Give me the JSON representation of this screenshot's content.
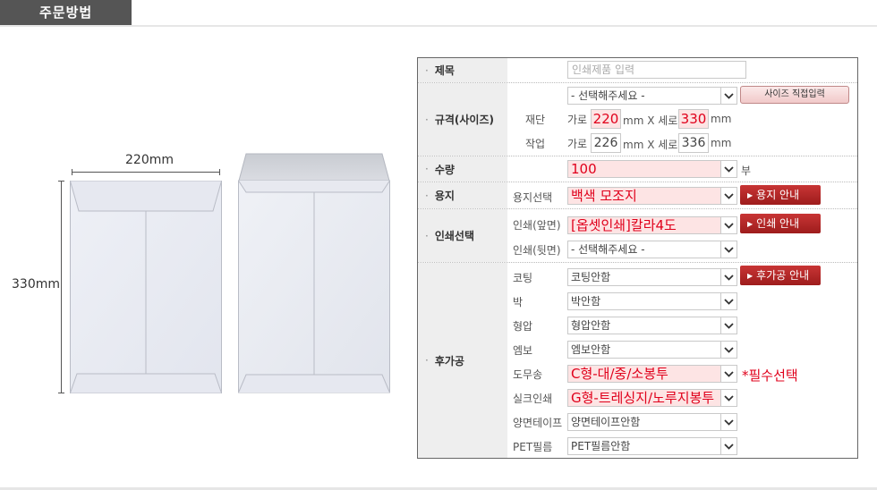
{
  "header": {
    "tab_title": "주문방법"
  },
  "illustration": {
    "width_label": "220mm",
    "height_label": "330mm"
  },
  "form": {
    "title_row": {
      "label": "제목",
      "input_placeholder": "인쇄제품 입력"
    },
    "size_row": {
      "label": "규격(사이즈)",
      "select_value": "- 선택해주세요 -",
      "direct_button": "사이즈 직접입력",
      "cut": {
        "label": "재단",
        "w_label": "가로",
        "w_value": "220",
        "unit1": "mm X 세로",
        "h_value": "330",
        "unit2": "mm"
      },
      "work": {
        "label": "작업",
        "w_label": "가로",
        "w_value": "226",
        "unit1": "mm X 세로",
        "h_value": "336",
        "unit2": "mm"
      }
    },
    "qty_row": {
      "label": "수량",
      "select_value": "100",
      "unit": "부"
    },
    "paper_row": {
      "label": "용지",
      "sublabel": "용지선택",
      "select_value": "백색 모조지",
      "guide_button": "용지 안내"
    },
    "print_row": {
      "label": "인쇄선택",
      "front_label": "인쇄(앞면)",
      "front_value": "[옵셋인쇄]칼라4도",
      "guide_button": "인쇄 안내",
      "back_label": "인쇄(뒷면)",
      "back_value": "- 선택해주세요 -"
    },
    "post_row": {
      "label": "후가공",
      "guide_button": "후가공 안내",
      "required_note": "*필수선택",
      "items": [
        {
          "label": "코팅",
          "value": "코팅안함",
          "highlight": false
        },
        {
          "label": "박",
          "value": "박안함",
          "highlight": false
        },
        {
          "label": "형압",
          "value": "형압안함",
          "highlight": false
        },
        {
          "label": "엠보",
          "value": "엠보안함",
          "highlight": false
        },
        {
          "label": "도무송",
          "value": "C형-대/중/소봉투",
          "highlight": true
        },
        {
          "label": "실크인쇄",
          "value": "G형-트레싱지/노루지봉투",
          "highlight": true
        },
        {
          "label": "양면테이프",
          "value": "양면테이프안함",
          "highlight": false
        },
        {
          "label": "PET필름",
          "value": "PET필름안함",
          "highlight": false
        }
      ]
    }
  },
  "colors": {
    "accent_red": "#e0001b",
    "button_red": "#b02828",
    "label_bg": "#eeeeee",
    "tab_bg": "#555555"
  }
}
